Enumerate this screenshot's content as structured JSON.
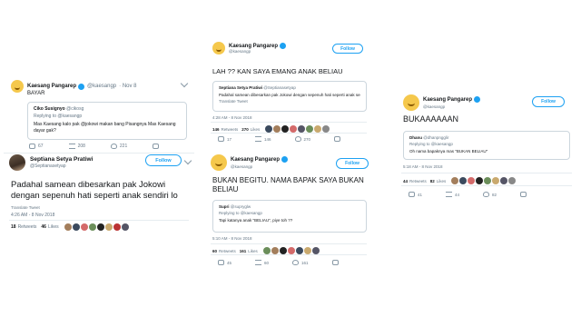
{
  "p1": {
    "top": {
      "name": "Kaesang Pangarep",
      "handle": "@kaesangp",
      "date": "· Nov 8",
      "text": "BAYAR"
    },
    "quote": {
      "name": "Ciko Susignyo",
      "handle": "@cikosg",
      "reply": "Replying to @kaesangp",
      "text": "Mas Kaesang kalo pak @jokowi makan bang Pisangnya Mas Kaesang dayar gak?"
    },
    "actions": [
      "67",
      "208",
      "221"
    ],
    "main": {
      "name": "Septiana Setya Pratiwi",
      "handle": "@Septianasetyap",
      "follow": "Follow",
      "text": "Padahal samean dibesarkan pak Jokowi dengan sepenuh hati seperti anak sendiri lo",
      "translate": "Translate Tweet",
      "time": "4:26 AM - 8 Nov 2018",
      "retweets": "18",
      "retweets_label": "Retweets",
      "likes": "46",
      "likes_label": "Likes"
    }
  },
  "p2": {
    "top": {
      "name": "Kaesang Pangarep",
      "handle": "@kaesangp",
      "follow": "Follow",
      "text": "LAH ?? KAN SAYA EMANG ANAK BELIAU"
    },
    "quote": {
      "name": "Septiana Setya Pratiwi",
      "handle": "@Septianasetyap",
      "text": "Padahal samean dibesarkan pak Jokowi dengan sepenuh hati seperti anak sendiri lo",
      "translate": "Translate Tweet"
    },
    "time": "4:28 AM - 8 Nov 2018",
    "stats": {
      "retweets": "146",
      "retweets_label": "Retweets",
      "likes": "270",
      "likes_label": "Likes"
    },
    "actions": [
      "17",
      "146",
      "270"
    ],
    "main": {
      "name": "Kaesang Pangarep",
      "handle": "@kaesangp",
      "follow": "Follow",
      "text": "BUKAN BEGITU. NAMA BAPAK SAYA BUKAN BELIAU"
    },
    "quote2": {
      "name": "Supri",
      "handle": "@supryglw",
      "reply": "Replying to @kaesangp",
      "text": "Tapi katanya anak \"BELIAU\", piye toh ??"
    },
    "time2": "5:10 AM - 8 Nov 2018",
    "stats2": {
      "retweets": "60",
      "retweets_label": "Retweets",
      "likes": "161",
      "likes_label": "Likes"
    },
    "actions2": [
      "45",
      "60",
      "161"
    ]
  },
  "p3": {
    "top": {
      "name": "Kaesang Pangarep",
      "handle": "@kaesangp",
      "follow": "Follow",
      "text": "BUKAAAAAAN"
    },
    "quote": {
      "name": "Dhanu",
      "handle": "@dhanpngglir",
      "reply": "Replying to @kaesangp",
      "text": "Oh nama bapaknya mas \"BUKAN BELIAU\""
    },
    "time": "5:18 AM - 8 Nov 2018",
    "stats": {
      "retweets": "44",
      "retweets_label": "Retweets",
      "likes": "82",
      "likes_label": "Likes"
    },
    "actions": [
      "41",
      "44",
      "82"
    ]
  },
  "colors": {
    "twitter_blue": "#1da1f2",
    "text": "#14171a",
    "muted": "#657786",
    "border": "#e6ecf0"
  }
}
